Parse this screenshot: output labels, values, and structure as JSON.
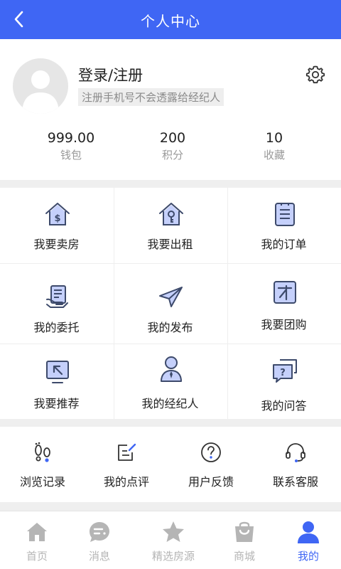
{
  "header": {
    "title": "个人中心"
  },
  "profile": {
    "login_label": "登录/注册",
    "hint": "注册手机号不会透露给经纪人",
    "stats": [
      {
        "value": "999.00",
        "label": "钱包"
      },
      {
        "value": "200",
        "label": "积分"
      },
      {
        "value": "10",
        "label": "收藏"
      }
    ]
  },
  "features": [
    {
      "label": "我要卖房",
      "icon": "house-dollar-icon"
    },
    {
      "label": "我要出租",
      "icon": "house-key-icon"
    },
    {
      "label": "我的订单",
      "icon": "order-list-icon"
    },
    {
      "label": "我的委托",
      "icon": "entrust-document-icon"
    },
    {
      "label": "我的发布",
      "icon": "paper-plane-icon"
    },
    {
      "label": "我要团购",
      "icon": "group-buy-icon"
    },
    {
      "label": "我要推荐",
      "icon": "recommend-screen-icon"
    },
    {
      "label": "我的经纪人",
      "icon": "agent-person-icon"
    },
    {
      "label": "我的问答",
      "icon": "question-chat-icon"
    }
  ],
  "services": [
    {
      "label": "浏览记录",
      "icon": "footprints-icon"
    },
    {
      "label": "我的点评",
      "icon": "review-edit-icon"
    },
    {
      "label": "用户反馈",
      "icon": "feedback-question-icon"
    },
    {
      "label": "联系客服",
      "icon": "headset-icon"
    }
  ],
  "tabs": [
    {
      "label": "首页",
      "icon": "home-icon"
    },
    {
      "label": "消息",
      "icon": "message-icon"
    },
    {
      "label": "精选房源",
      "icon": "star-icon"
    },
    {
      "label": "商城",
      "icon": "shopping-bag-icon"
    },
    {
      "label": "我的",
      "icon": "person-icon",
      "active": true
    }
  ],
  "colors": {
    "accent": "#3f66f4",
    "icon_fill": "#c5d0fb",
    "icon_stroke": "#3d4a6b",
    "tab_inactive": "#b5b5b5"
  }
}
